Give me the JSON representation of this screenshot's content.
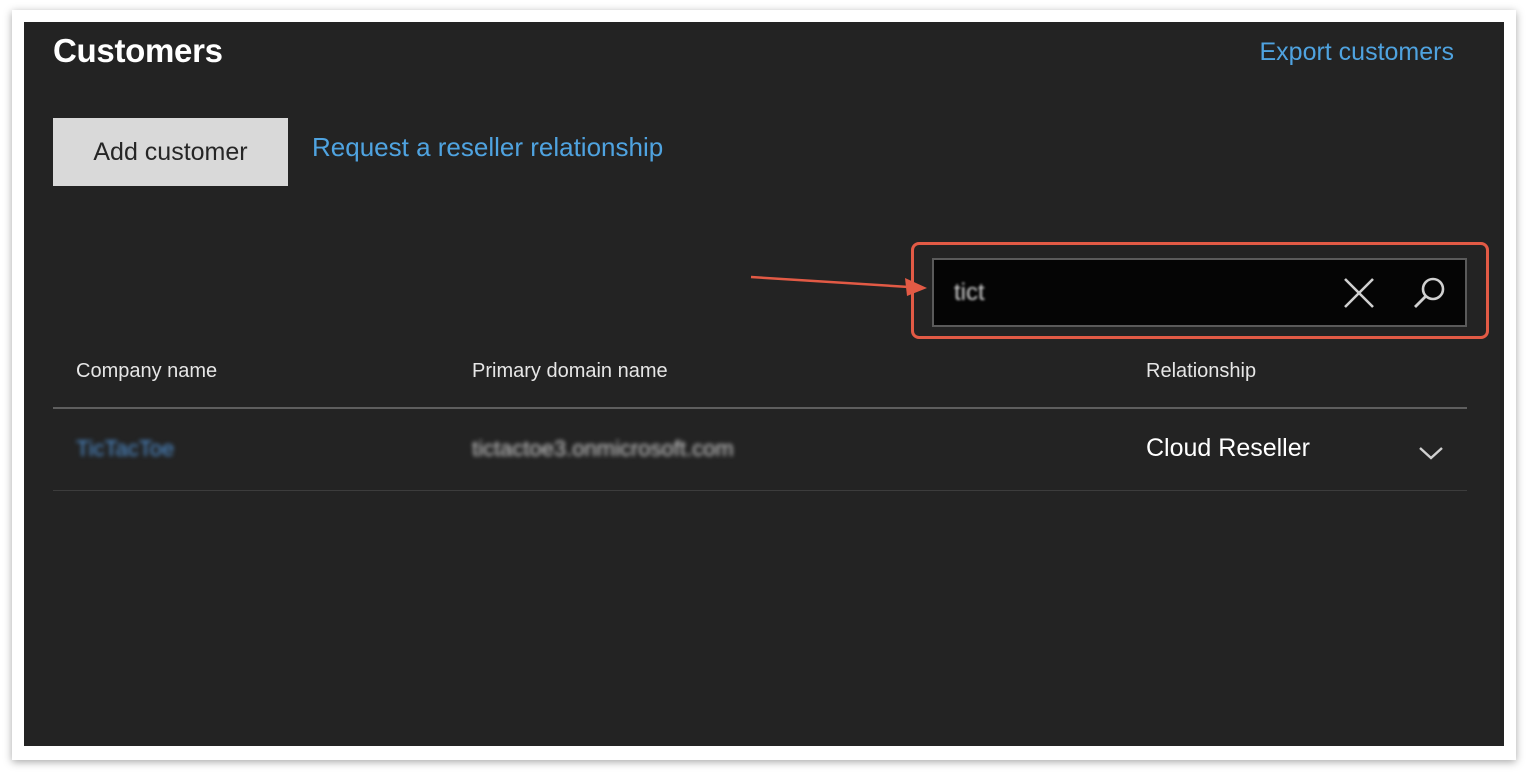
{
  "page": {
    "title": "Customers",
    "export_link": "Export customers"
  },
  "actions": {
    "add_customer_label": "Add customer",
    "request_reseller_label": "Request a reseller relationship"
  },
  "search": {
    "value": "tict",
    "clear_icon": "close-icon",
    "search_icon": "search-icon"
  },
  "table": {
    "columns": [
      "Company name",
      "Primary domain name",
      "Relationship"
    ],
    "rows": [
      {
        "company_name": "TicTacToe",
        "primary_domain": "tictactoe3.onmicrosoft.com",
        "relationship": "Cloud Reseller"
      }
    ]
  },
  "colors": {
    "background": "#232323",
    "link": "#4fa3e0",
    "highlight": "#e25a45",
    "button": "#d9d9d9"
  }
}
